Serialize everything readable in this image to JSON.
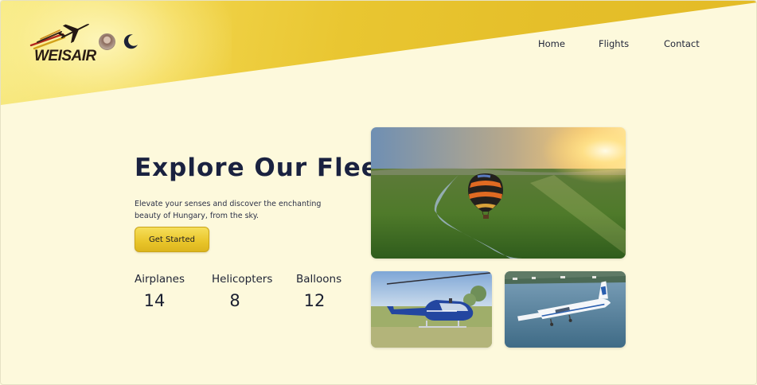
{
  "brand": {
    "logo_text": "WEISAIR"
  },
  "nav": {
    "items": [
      "Home",
      "Flights",
      "Contact"
    ]
  },
  "hero": {
    "title": "Explore Our Fleet",
    "description": "Elevate your senses and discover the enchanting beauty of Hungary, from the sky.",
    "cta_label": "Get Started"
  },
  "stats": [
    {
      "label": "Airplanes",
      "value": "14"
    },
    {
      "label": "Helicopters",
      "value": "8"
    },
    {
      "label": "Balloons",
      "value": "12"
    }
  ],
  "colors": {
    "background": "#fdf9dc",
    "accent": "#e9c52a",
    "heading": "#1a2240"
  },
  "icons": [
    "airplane-logo-icon",
    "avatar",
    "moon-icon"
  ],
  "images": [
    "hot-air-balloon-photo",
    "helicopter-photo",
    "airplane-photo"
  ]
}
